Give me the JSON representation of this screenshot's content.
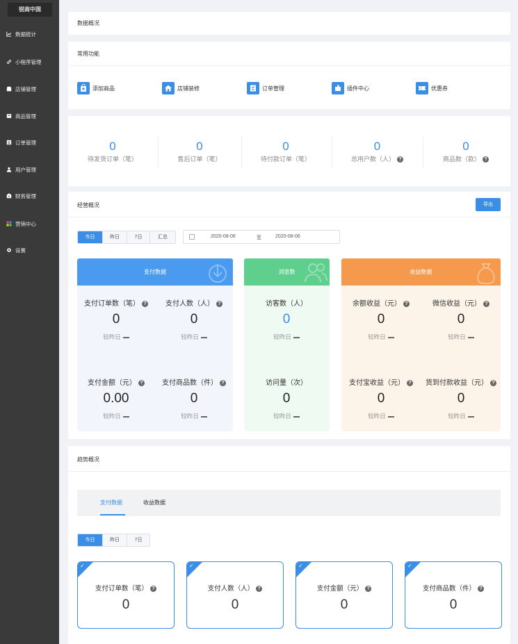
{
  "sidebar": {
    "brand": "锐商中国",
    "items": [
      {
        "label": "数据统计",
        "icon": "chart-line-icon"
      },
      {
        "label": "小程序管理",
        "icon": "link-icon"
      },
      {
        "label": "店铺管理",
        "icon": "store-icon"
      },
      {
        "label": "商品管理",
        "icon": "product-icon"
      },
      {
        "label": "订单管理",
        "icon": "order-icon"
      },
      {
        "label": "用户管理",
        "icon": "user-icon"
      },
      {
        "label": "财务管理",
        "icon": "finance-icon"
      },
      {
        "label": "营销中心",
        "icon": "marketing-icon"
      },
      {
        "label": "设置",
        "icon": "settings-icon"
      }
    ]
  },
  "header": {
    "title": "数据概况"
  },
  "functions": {
    "title": "常用功能",
    "items": [
      {
        "label": "添加商品",
        "icon": "add-product-icon"
      },
      {
        "label": "店铺装修",
        "icon": "store-decor-icon"
      },
      {
        "label": "订单管理",
        "icon": "order-manage-icon"
      },
      {
        "label": "插件中心",
        "icon": "plugin-icon"
      },
      {
        "label": "优惠券",
        "icon": "coupon-icon"
      }
    ]
  },
  "stats": [
    {
      "value": "0",
      "label": "待发货订单（笔）"
    },
    {
      "value": "0",
      "label": "售后订单（笔）"
    },
    {
      "value": "0",
      "label": "待付款订单（笔）"
    },
    {
      "value": "0",
      "label": "总用户数（人）"
    },
    {
      "value": "0",
      "label": "商品数（款）"
    }
  ],
  "business": {
    "title": "经营概况",
    "export_label": "导出",
    "periods": [
      "今日",
      "昨日",
      "7日",
      "汇总"
    ],
    "date_start": "2020-08-06",
    "date_sep": "至",
    "date_end": "2020-08-06",
    "compare_label": "较昨日",
    "pay": {
      "title": "支付数据",
      "items": [
        {
          "label": "支付订单数（笔）",
          "value": "0"
        },
        {
          "label": "支付人数（人）",
          "value": "0"
        },
        {
          "label": "支付金额（元）",
          "value": "0.00"
        },
        {
          "label": "支付商品数（件）",
          "value": "0"
        }
      ]
    },
    "views": {
      "title": "浏览数",
      "items": [
        {
          "label": "访客数（人）",
          "value": "0"
        },
        {
          "label": "访问量（次）",
          "value": "0"
        }
      ]
    },
    "income": {
      "title": "收益数据",
      "items": [
        {
          "label": "余额收益（元）",
          "value": "0"
        },
        {
          "label": "微信收益（元）",
          "value": "0"
        },
        {
          "label": "支付宝收益（元）",
          "value": "0"
        },
        {
          "label": "货到付款收益（元）",
          "value": "0"
        }
      ]
    }
  },
  "trend": {
    "title": "趋势概况",
    "tabs": [
      "支付数据",
      "收益数据"
    ],
    "periods": [
      "今日",
      "昨日",
      "7日"
    ],
    "metrics": [
      {
        "label": "支付订单数（笔）",
        "value": "0"
      },
      {
        "label": "支付人数（人）",
        "value": "0"
      },
      {
        "label": "支付金额（元）",
        "value": "0"
      },
      {
        "label": "支付商品数（件）",
        "value": "0"
      }
    ]
  },
  "colors": {
    "accent": "#3a8ee6",
    "green": "#5fcf8e",
    "orange": "#f59a4c",
    "sidebar": "#3a3a3a"
  }
}
